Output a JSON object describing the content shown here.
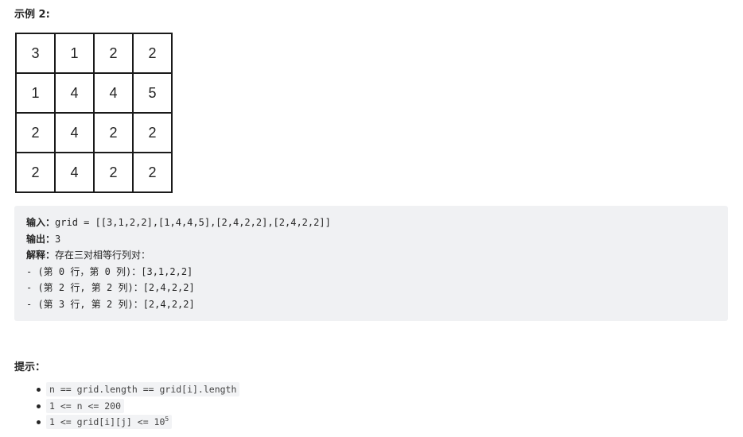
{
  "example_heading": "示例 2:",
  "grid": [
    [
      "3",
      "1",
      "2",
      "2"
    ],
    [
      "1",
      "4",
      "4",
      "5"
    ],
    [
      "2",
      "4",
      "2",
      "2"
    ],
    [
      "2",
      "4",
      "2",
      "2"
    ]
  ],
  "example": {
    "input_label": "输入：",
    "input_value": "grid = [[3,1,2,2],[1,4,4,5],[2,4,2,2],[2,4,2,2]]",
    "output_label": "输出：",
    "output_value": "3",
    "explanation_label": "解释：",
    "explanation_value": "存在三对相等行列对：",
    "pairs": [
      "- (第 0 行，第 0 列)：[3,1,2,2]",
      "- (第 2 行, 第 2 列)：[2,4,2,2]",
      "- (第 3 行, 第 2 列)：[2,4,2,2]"
    ]
  },
  "hints_heading": "提示：",
  "hints": {
    "item1": "n == grid.length == grid[i].length",
    "item2": "1 <= n <= 200",
    "item3_base": "1 <= grid[i][j] <= 10",
    "item3_exponent": "5"
  }
}
